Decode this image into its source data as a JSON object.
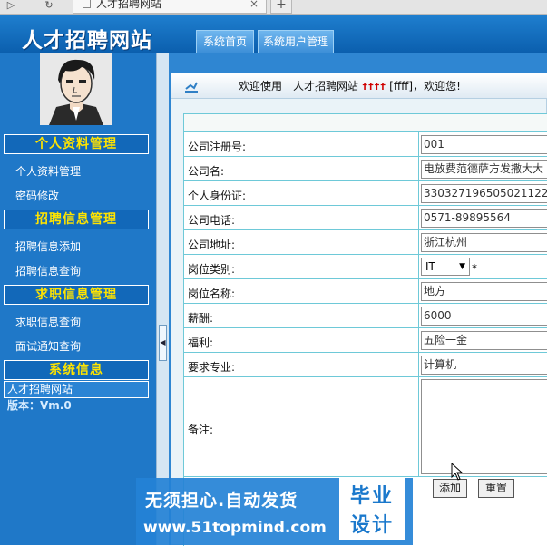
{
  "browser": {
    "tab_title": "人才招聘网站",
    "tab_close": "×",
    "new_tab": "+"
  },
  "header": {
    "site_title": "人才招聘网站",
    "nav": [
      "系统首页",
      "系统用户管理"
    ]
  },
  "sidebar": {
    "sections": [
      {
        "title": "个人资料管理",
        "items": [
          "个人资料管理",
          "密码修改"
        ]
      },
      {
        "title": "招聘信息管理",
        "items": [
          "招聘信息添加",
          "招聘信息查询"
        ]
      },
      {
        "title": "求职信息管理",
        "items": [
          "求职信息查询",
          "面试通知查询"
        ]
      },
      {
        "title": "系统信息",
        "items": []
      }
    ],
    "system_name": "人才招聘网站",
    "version": "版本：Vm.0"
  },
  "welcome": {
    "prefix": "欢迎使用　人才招聘网站",
    "user": "ffff",
    "suffix": "[ffff]，欢迎您!"
  },
  "form": {
    "rows": [
      {
        "label": "公司注册号:",
        "value": "001"
      },
      {
        "label": "公司名:",
        "value": "电放费范德萨方发撒大大"
      },
      {
        "label": "个人身份证:",
        "value": "330327196505021122"
      },
      {
        "label": "公司电话:",
        "value": "0571-89895564"
      },
      {
        "label": "公司地址:",
        "value": "浙江杭州"
      },
      {
        "label": "岗位类别:",
        "value": "IT"
      },
      {
        "label": "岗位名称:",
        "value": "地方"
      },
      {
        "label": "薪酬:",
        "value": "6000"
      },
      {
        "label": "福利:",
        "value": "五险一金"
      },
      {
        "label": "要求专业:",
        "value": "计算机"
      },
      {
        "label": "备注:",
        "value": ""
      }
    ],
    "select_arrow": "▼",
    "required_mark": "*",
    "add_label": "添加",
    "reset_label": "重置"
  },
  "ad": {
    "line1": "无须担心.自动发货",
    "line2": "www.51topmind.com",
    "badge1": "毕业",
    "badge2": "设计"
  },
  "colors": {
    "header_blue": "#0b5fae",
    "sidebar_blue": "#1f78c8",
    "section_title": "#ffe400",
    "username_red": "#d00000",
    "table_border": "#6ec9d8"
  }
}
